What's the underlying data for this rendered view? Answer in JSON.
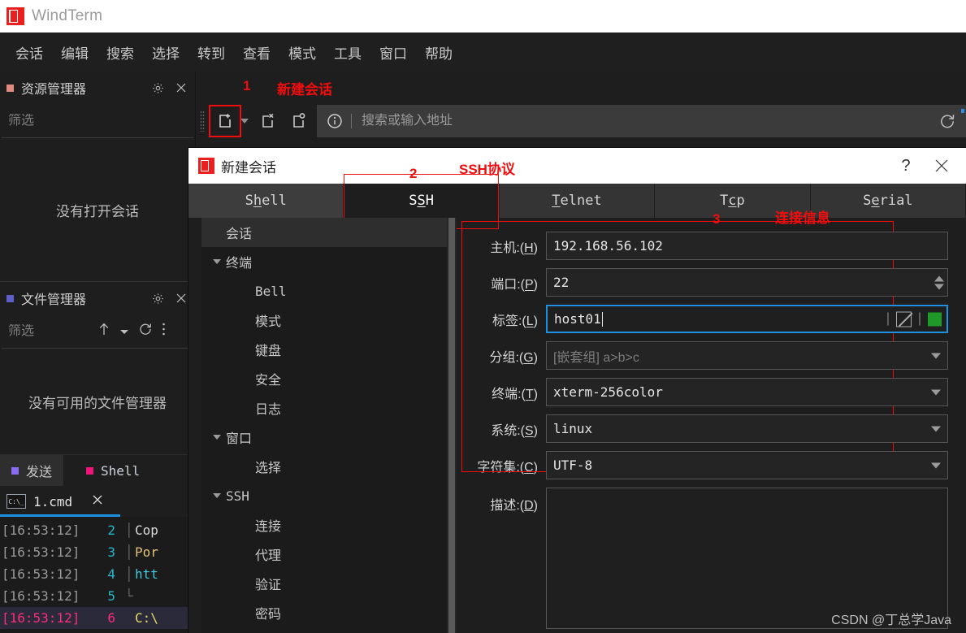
{
  "app": {
    "title": "WindTerm",
    "logo_color": "#e8201f"
  },
  "menubar": {
    "items": [
      {
        "label": "会话"
      },
      {
        "label": "编辑"
      },
      {
        "label": "搜索"
      },
      {
        "label": "选择"
      },
      {
        "label": "转到"
      },
      {
        "label": "查看"
      },
      {
        "label": "模式"
      },
      {
        "label": "工具"
      },
      {
        "label": "窗口"
      },
      {
        "label": "帮助"
      }
    ]
  },
  "sidebar": {
    "explorer": {
      "title": "资源管理器",
      "dot_color": "#e08a80",
      "filter_placeholder": "筛选",
      "empty_text": "没有打开会话",
      "gear_icon": "gear-icon",
      "close_icon": "close-icon"
    },
    "filemanager": {
      "title": "文件管理器",
      "dot_color": "#5b5fc7",
      "filter_placeholder": "筛选",
      "empty_text": "没有可用的文件管理器",
      "tools": [
        "up-arrow-icon",
        "chevron-down-icon",
        "refresh-icon",
        "more-vertical-icon"
      ]
    },
    "bottom_tabs": [
      {
        "label": "发送",
        "dot_color": "#8a6cf0",
        "selected": true
      },
      {
        "label": "Shell",
        "dot_color": "#f0137a",
        "selected": false
      }
    ],
    "file_tab": {
      "name": "1.cmd",
      "icon": "cmd-file-icon",
      "close_icon": "close-icon"
    },
    "terminal_lines": [
      {
        "time": "[16:53:12]",
        "num": "2",
        "text": "Cop",
        "current": false
      },
      {
        "time": "[16:53:12]",
        "num": "3",
        "text": "Por",
        "current": false
      },
      {
        "time": "[16:53:12]",
        "num": "4",
        "text": "htt",
        "current": false
      },
      {
        "time": "[16:53:12]",
        "num": "5",
        "text": "",
        "current": false
      },
      {
        "time": "[16:53:12]",
        "num": "6",
        "text": "C:\\",
        "current": true
      }
    ]
  },
  "toolbar": {
    "annotation_number": "1",
    "annotation_text": "新建会话",
    "new_session_icon": "new-session-icon",
    "dropdown_icon": "chevron-down-icon",
    "close_session_icon": "close-session-icon",
    "clone_session_icon": "clone-session-icon",
    "info_icon": "info-icon",
    "address_placeholder": "搜索或输入地址",
    "address_value": "",
    "reload_icon": "reload-icon"
  },
  "dialog": {
    "title": "新建会话",
    "help_label": "?",
    "close_label": "✕",
    "annotations": {
      "tab_number": "2",
      "tab_text": "SSH协议",
      "form_number": "3",
      "form_text": "连接信息"
    },
    "tabs": [
      {
        "pre": "S",
        "key": "h",
        "post": "ell",
        "selected": false
      },
      {
        "pre": "S",
        "key": "S",
        "post": "H",
        "selected": true
      },
      {
        "pre": "",
        "key": "T",
        "post": "elnet",
        "selected": false
      },
      {
        "pre": "T",
        "key": "c",
        "post": "p",
        "selected": false
      },
      {
        "pre": "S",
        "key": "e",
        "post": "rial",
        "selected": false
      }
    ],
    "tree": [
      {
        "label": "会话",
        "level": 1,
        "expander": false,
        "selected": true,
        "mono": false
      },
      {
        "label": "终端",
        "level": 1,
        "expander": true,
        "selected": false,
        "mono": false
      },
      {
        "label": "Bell",
        "level": 2,
        "expander": false,
        "selected": false,
        "mono": true
      },
      {
        "label": "模式",
        "level": 2,
        "expander": false,
        "selected": false,
        "mono": false
      },
      {
        "label": "键盘",
        "level": 2,
        "expander": false,
        "selected": false,
        "mono": false
      },
      {
        "label": "安全",
        "level": 2,
        "expander": false,
        "selected": false,
        "mono": false
      },
      {
        "label": "日志",
        "level": 2,
        "expander": false,
        "selected": false,
        "mono": false
      },
      {
        "label": "窗口",
        "level": 1,
        "expander": true,
        "selected": false,
        "mono": false
      },
      {
        "label": "选择",
        "level": 2,
        "expander": false,
        "selected": false,
        "mono": false
      },
      {
        "label": "SSH",
        "level": 1,
        "expander": true,
        "selected": false,
        "mono": true
      },
      {
        "label": "连接",
        "level": 2,
        "expander": false,
        "selected": false,
        "mono": false
      },
      {
        "label": "代理",
        "level": 2,
        "expander": false,
        "selected": false,
        "mono": false
      },
      {
        "label": "验证",
        "level": 2,
        "expander": false,
        "selected": false,
        "mono": false
      },
      {
        "label": "密码",
        "level": 2,
        "expander": false,
        "selected": false,
        "mono": false
      }
    ],
    "fields": {
      "host": {
        "label_pre": "主机:(",
        "key": "H",
        "label_post": ")",
        "value": "192.168.56.102",
        "type": "text"
      },
      "port": {
        "label_pre": "端口:(",
        "key": "P",
        "label_post": ")",
        "value": "22",
        "type": "spinner"
      },
      "label": {
        "label_pre": "标签:(",
        "key": "L",
        "label_post": ")",
        "value": "host01",
        "type": "label",
        "focused": true,
        "swatch_color": "#1f9a28"
      },
      "group": {
        "label_pre": "分组:(",
        "key": "G",
        "label_post": ")",
        "value": "",
        "placeholder": "[嵌套组]  a>b>c",
        "type": "combo"
      },
      "terminal": {
        "label_pre": "终端:(",
        "key": "T",
        "label_post": ")",
        "value": "xterm-256color",
        "type": "combo"
      },
      "system": {
        "label_pre": "系统:(",
        "key": "S",
        "label_post": ")",
        "value": "linux",
        "type": "combo"
      },
      "charset": {
        "label_pre": "字符集:(",
        "key": "C",
        "label_post": ")",
        "value": "UTF-8",
        "type": "combo"
      },
      "desc": {
        "label_pre": "描述:(",
        "key": "D",
        "label_post": ")",
        "value": "",
        "type": "textarea"
      }
    },
    "watermark": "CSDN @丁总学Java"
  }
}
